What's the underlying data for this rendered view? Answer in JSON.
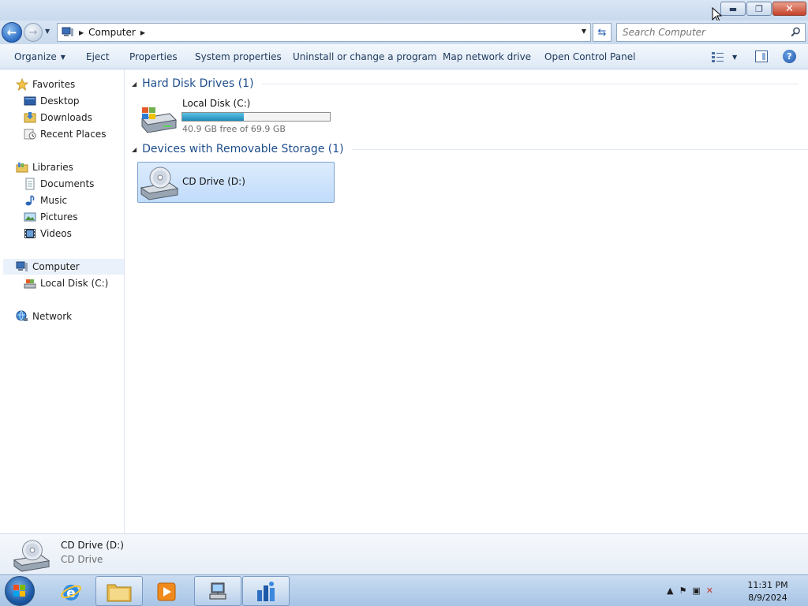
{
  "window": {
    "title": "Computer",
    "controls": {
      "minimize": "minimize",
      "restore": "restore",
      "close": "close"
    }
  },
  "navbar": {
    "address_text": "Computer",
    "search_placeholder": "Search Computer"
  },
  "toolbar": {
    "organize": "Organize",
    "eject": "Eject",
    "properties": "Properties",
    "system_properties": "System properties",
    "uninstall": "Uninstall or change a program",
    "map_drive": "Map network drive",
    "control_panel": "Open Control Panel"
  },
  "sidebar": {
    "favorites": {
      "label": "Favorites",
      "items": [
        {
          "label": "Desktop"
        },
        {
          "label": "Downloads"
        },
        {
          "label": "Recent Places"
        }
      ]
    },
    "libraries": {
      "label": "Libraries",
      "items": [
        {
          "label": "Documents"
        },
        {
          "label": "Music"
        },
        {
          "label": "Pictures"
        },
        {
          "label": "Videos"
        }
      ]
    },
    "computer": {
      "label": "Computer",
      "items": [
        {
          "label": "Local Disk (C:)"
        }
      ]
    },
    "network": {
      "label": "Network"
    }
  },
  "main": {
    "groups": [
      {
        "title": "Hard Disk Drives (1)",
        "drive": {
          "name": "Local Disk (C:)",
          "free_text": "40.9 GB free of 69.9 GB",
          "used_fraction": 0.415
        }
      },
      {
        "title": "Devices with Removable Storage (1)",
        "drive": {
          "name": "CD Drive (D:)"
        }
      }
    ]
  },
  "details": {
    "name": "CD Drive (D:)",
    "type": "CD Drive"
  },
  "taskbar": {
    "time": "11:31 PM",
    "date": "8/9/2024"
  },
  "colors": {
    "accent": "#1e4e8c",
    "selection": "#c1dcfc",
    "capacity_bar": "#26a0da"
  }
}
